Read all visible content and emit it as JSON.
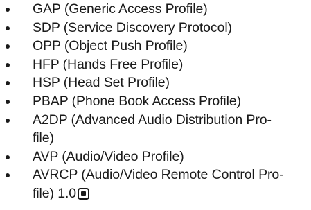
{
  "profiles": [
    {
      "lines": [
        "GAP (Generic Access Profile)"
      ]
    },
    {
      "lines": [
        "SDP (Service Discovery Protocol)"
      ]
    },
    {
      "lines": [
        "OPP (Object Push Profile)"
      ]
    },
    {
      "lines": [
        "HFP (Hands Free Profile)"
      ]
    },
    {
      "lines": [
        "HSP (Head Set Profile)"
      ]
    },
    {
      "lines": [
        "PBAP (Phone Book Access Profile)"
      ]
    },
    {
      "lines": [
        "A2DP (Advanced Audio Distribution Pro-",
        "file)"
      ]
    },
    {
      "lines": [
        "AVP (Audio/Video Profile)"
      ]
    },
    {
      "lines": [
        "AVRCP (Audio/Video Remote Control Pro-",
        "file) 1.0"
      ]
    }
  ],
  "end_mark_icon": "end-of-section-icon"
}
